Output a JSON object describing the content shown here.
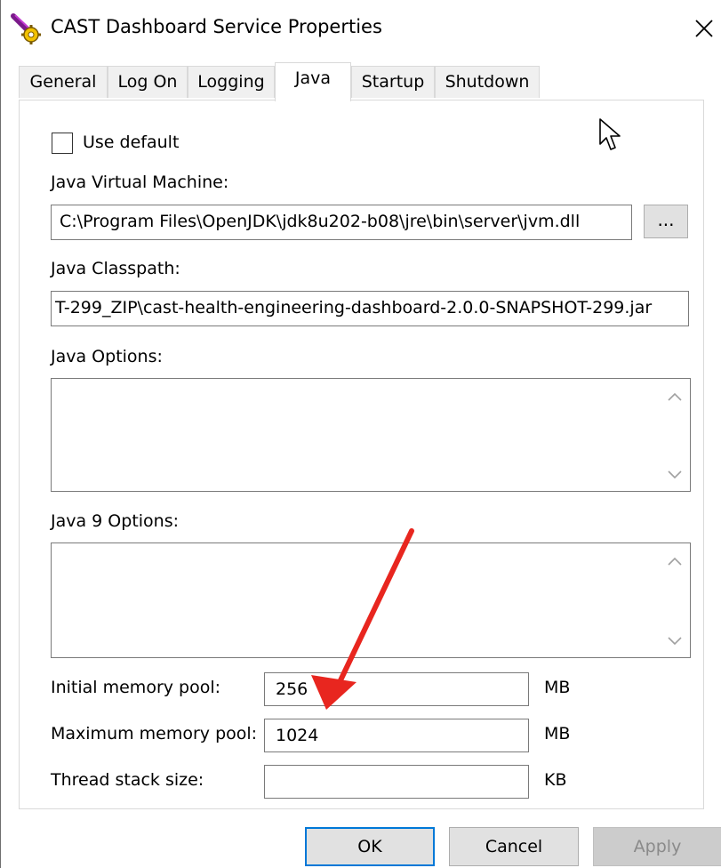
{
  "window": {
    "title": "CAST Dashboard Service Properties",
    "close_glyph": "✕",
    "accent_color": "#0078d7"
  },
  "tabs": [
    {
      "label": "General",
      "active": false
    },
    {
      "label": "Log On",
      "active": false
    },
    {
      "label": "Logging",
      "active": false
    },
    {
      "label": "Java",
      "active": true
    },
    {
      "label": "Startup",
      "active": false
    },
    {
      "label": "Shutdown",
      "active": false
    }
  ],
  "java": {
    "use_default_label": "Use default",
    "use_default_checked": false,
    "jvm_label": "Java Virtual Machine:",
    "jvm_value": "C:\\Program Files\\OpenJDK\\jdk8u202-b08\\jre\\bin\\server\\jvm.dll",
    "browse_label": "...",
    "classpath_label": "Java Classpath:",
    "classpath_value": "T-299_ZIP\\cast-health-engineering-dashboard-2.0.0-SNAPSHOT-299.jar",
    "options_label": "Java Options:",
    "options_value": "",
    "java9_options_label": "Java 9 Options:",
    "java9_options_value": "",
    "initial_pool_label": "Initial memory pool:",
    "initial_pool_value": "256",
    "initial_pool_unit": "MB",
    "max_pool_label": "Maximum memory pool:",
    "max_pool_value": "1024",
    "max_pool_unit": "MB",
    "thread_stack_label": "Thread stack size:",
    "thread_stack_value": "",
    "thread_stack_unit": "KB"
  },
  "buttons": {
    "ok": "OK",
    "cancel": "Cancel",
    "apply": "Apply"
  },
  "annotation": {
    "arrow_color": "#e8261f"
  }
}
